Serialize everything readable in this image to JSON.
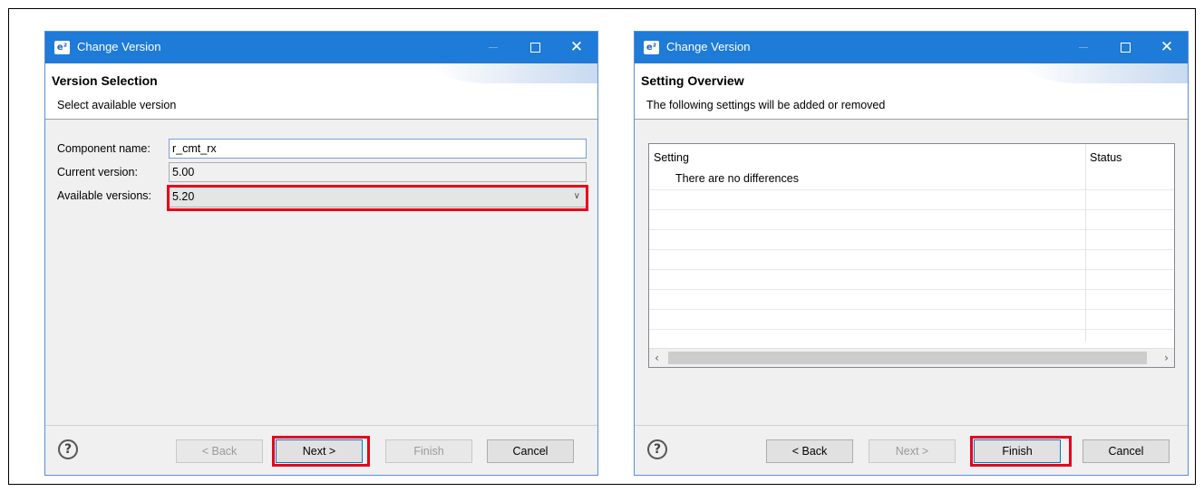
{
  "dialogs": [
    {
      "title": "Change Version",
      "header_title": "Version Selection",
      "header_subtitle": "Select available version",
      "fields": {
        "component_name_label": "Component name:",
        "component_name_value": "r_cmt_rx",
        "current_version_label": "Current version:",
        "current_version_value": "5.00",
        "available_versions_label": "Available versions:",
        "available_versions_value": "5.20"
      },
      "buttons": {
        "back": "< Back",
        "next": "Next >",
        "finish": "Finish",
        "cancel": "Cancel"
      }
    },
    {
      "title": "Change Version",
      "header_title": "Setting Overview",
      "header_subtitle": "The following settings will be added or removed",
      "table": {
        "columns": [
          "Setting",
          "Status"
        ],
        "rows": [
          "There are no differences"
        ]
      },
      "buttons": {
        "back": "< Back",
        "next": "Next >",
        "finish": "Finish",
        "cancel": "Cancel"
      }
    }
  ],
  "icons": {
    "app": "e²",
    "help": "?",
    "close": "✕",
    "dropdown": "chevron-down-icon",
    "scroll_left": "‹",
    "scroll_right": "›"
  },
  "colors": {
    "titlebar": "#1e7bd8",
    "highlight": "#e8001c",
    "window_bg": "#f0f0f0"
  }
}
